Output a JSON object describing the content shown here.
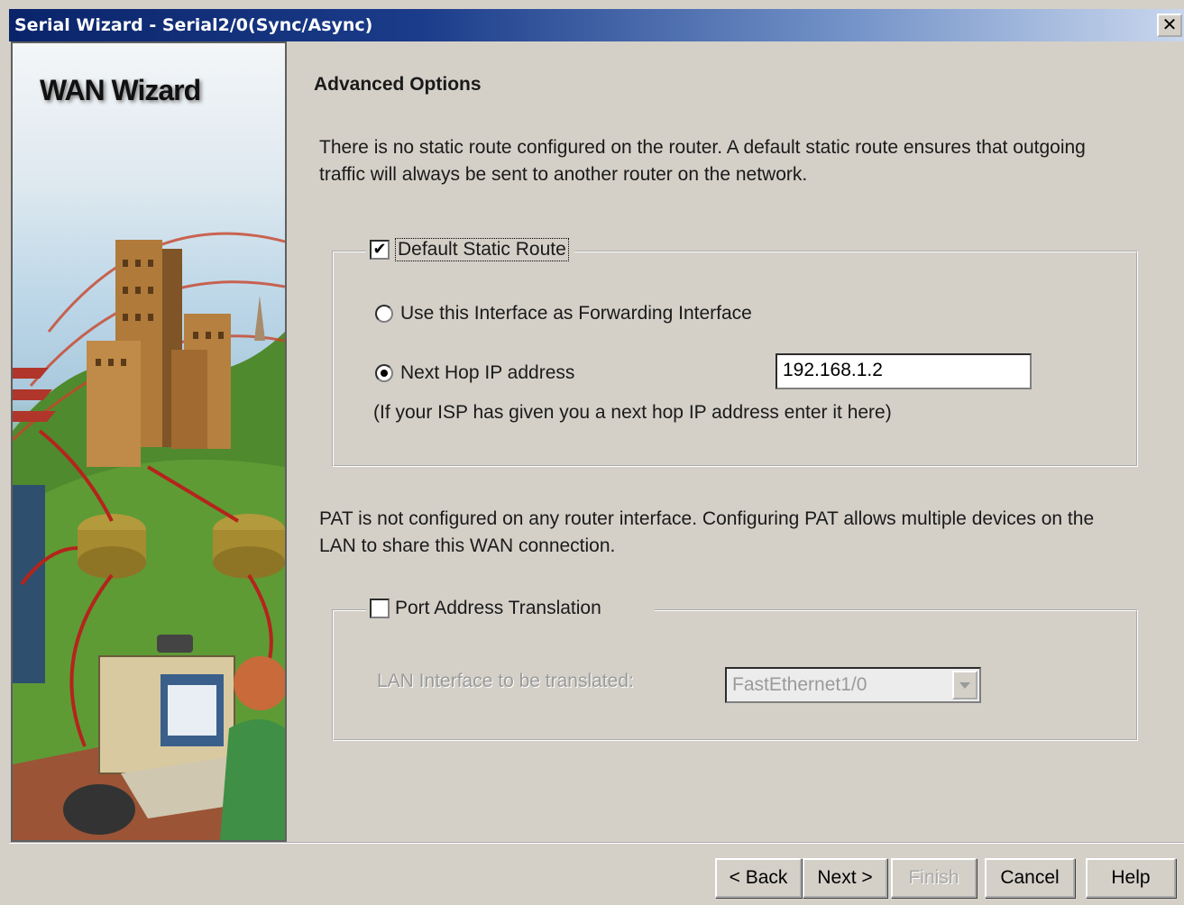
{
  "window": {
    "title": "Serial Wizard - Serial2/0(Sync/Async)",
    "close_glyph": "✕"
  },
  "banner": {
    "title": "WAN Wizard"
  },
  "main": {
    "heading": "Advanced Options",
    "static_route_description": "There is no static route configured on the router. A default static route ensures that outgoing traffic will always be sent to another router on the network.",
    "static_route_group": {
      "label": "Default Static Route",
      "checked": true,
      "option_forwarding_interface": "Use this Interface as Forwarding Interface",
      "option_next_hop": "Next Hop IP address",
      "selected_option": "next_hop",
      "next_hop_value": "192.168.1.2",
      "next_hop_hint": "(If your ISP has given you a next hop IP address enter it here)"
    },
    "pat_description": "PAT is not configured on any router interface. Configuring PAT allows multiple devices on the LAN to share this WAN connection.",
    "pat_group": {
      "label": "Port Address Translation",
      "checked": false,
      "lan_interface_label": "LAN Interface to be translated:",
      "lan_interface_value": "FastEthernet1/0"
    }
  },
  "footer": {
    "back_label": "< Back",
    "next_label": "Next >",
    "finish_label": "Finish",
    "cancel_label": "Cancel",
    "help_label": "Help"
  },
  "colors": {
    "window_bg": "#d4d0c8",
    "titlebar_start": "#0a246a",
    "titlebar_end": "#c9d7ee",
    "disabled_text": "#9a9a9a"
  }
}
